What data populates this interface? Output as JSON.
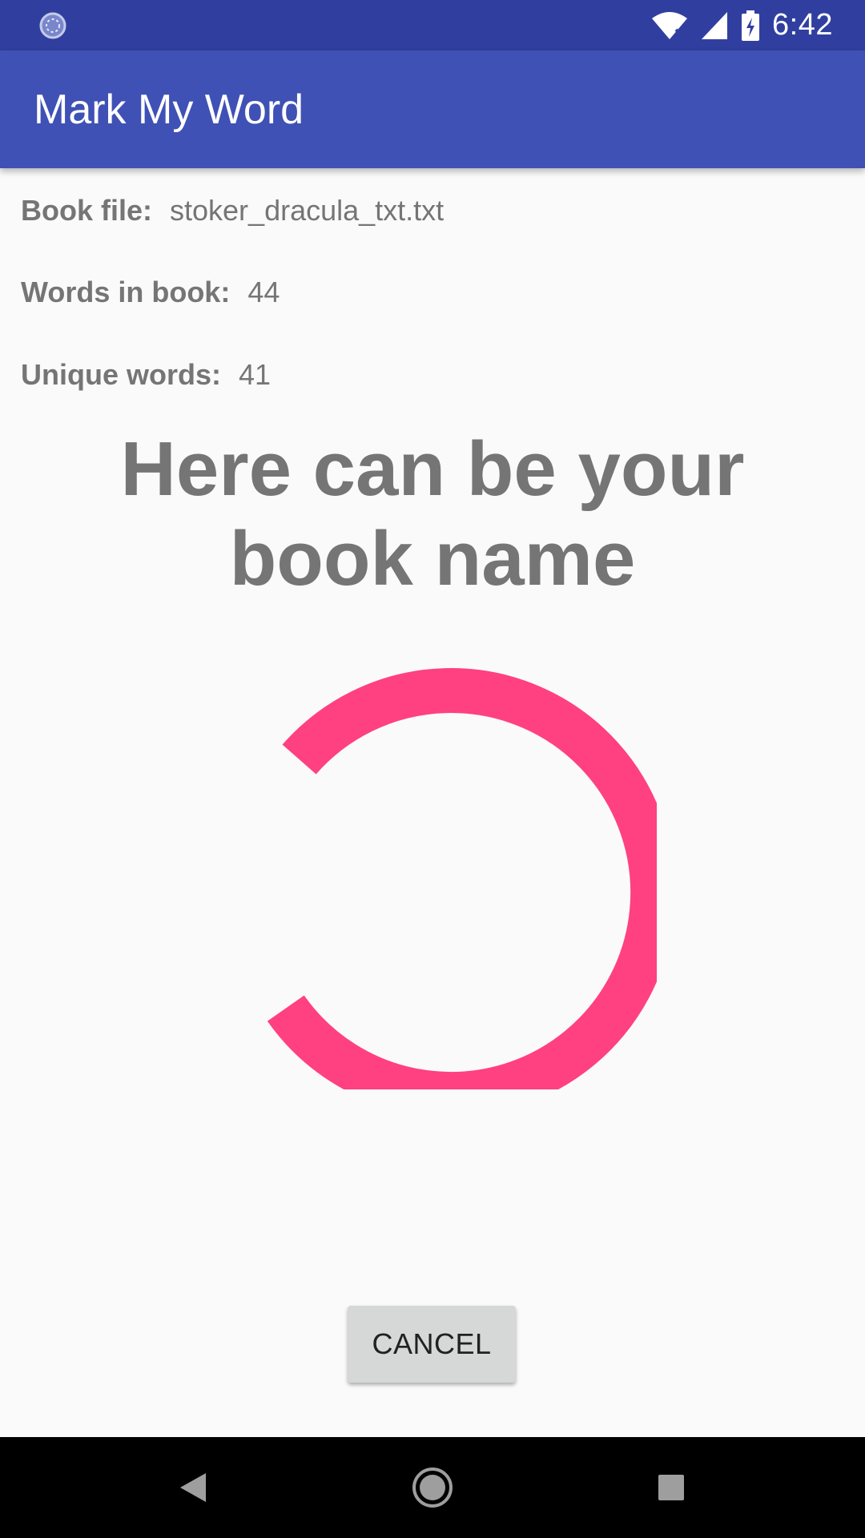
{
  "status_bar": {
    "time": "6:42",
    "icons": [
      "sync-icon",
      "wifi-icon",
      "cellular-icon",
      "battery-charging-icon"
    ],
    "color": "#303f9f"
  },
  "app_bar": {
    "title": "Mark My Word",
    "color": "#3f51b5"
  },
  "info": {
    "book_file_label": "Book file:",
    "book_file_value": "stoker_dracula_txt.txt",
    "words_label": "Words in book:",
    "words_value": "44",
    "unique_label": "Unique words:",
    "unique_value": "41"
  },
  "book_title": "Here can be your book name",
  "progress": {
    "type": "indeterminate-circular",
    "color": "#ff4081"
  },
  "actions": {
    "cancel_label": "CANCEL"
  },
  "nav_bar": {
    "icons": [
      "back-icon",
      "home-icon",
      "recents-icon"
    ]
  }
}
